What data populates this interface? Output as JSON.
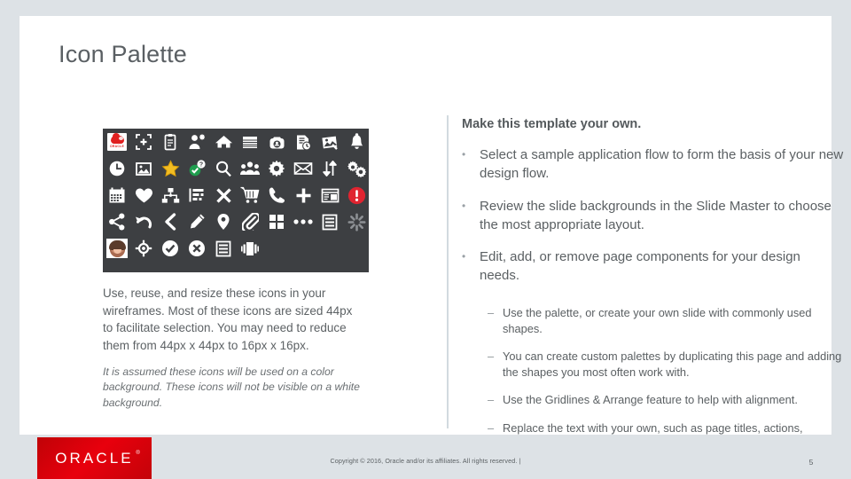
{
  "slide": {
    "title": "Icon Palette",
    "page_number": "5",
    "copyright": "Copyright © 2016, Oracle and/or its affiliates. All rights reserved.  |",
    "logo_text": "ORACLE"
  },
  "colors": {
    "page_background": "#dde2e6",
    "slide_background": "#ffffff",
    "palette_background": "#3d3f42",
    "title_text": "#5a5f63",
    "body_text": "#5b6063",
    "divider": "#d2dadf",
    "oracle_red": "#e8000d",
    "alert_red": "#e02430",
    "star_gold": "#f2bd23",
    "check_green": "#1f9d4e"
  },
  "palette": {
    "rows": [
      [
        {
          "name": "oracle-logo-badge-icon"
        },
        {
          "name": "focus-frame-add-icon"
        },
        {
          "name": "clipboard-icon"
        },
        {
          "name": "add-user-icon"
        },
        {
          "name": "home-icon"
        },
        {
          "name": "table-list-icon"
        },
        {
          "name": "briefcase-camera-icon"
        },
        {
          "name": "document-clock-icon"
        },
        {
          "name": "photo-stack-icon"
        },
        {
          "name": "bell-icon"
        }
      ],
      [
        {
          "name": "clock-icon"
        },
        {
          "name": "image-icon"
        },
        {
          "name": "star-icon"
        },
        {
          "name": "check-question-icon"
        },
        {
          "name": "search-icon"
        },
        {
          "name": "group-people-icon"
        },
        {
          "name": "gear-icon"
        },
        {
          "name": "envelope-icon"
        },
        {
          "name": "sort-arrows-icon"
        },
        {
          "name": "multi-gears-icon"
        }
      ],
      [
        {
          "name": "calendar-icon"
        },
        {
          "name": "heart-icon"
        },
        {
          "name": "org-chart-icon"
        },
        {
          "name": "gantt-chart-icon"
        },
        {
          "name": "close-x-icon"
        },
        {
          "name": "shopping-cart-icon"
        },
        {
          "name": "phone-icon"
        },
        {
          "name": "plus-icon"
        },
        {
          "name": "dashboard-window-icon"
        },
        {
          "name": "alert-circle-icon"
        }
      ],
      [
        {
          "name": "share-icon"
        },
        {
          "name": "undo-icon"
        },
        {
          "name": "chevron-left-icon"
        },
        {
          "name": "pencil-edit-icon"
        },
        {
          "name": "location-pin-icon"
        },
        {
          "name": "paperclip-icon"
        },
        {
          "name": "grid-tiles-icon"
        },
        {
          "name": "more-ellipsis-icon"
        },
        {
          "name": "list-lines-icon"
        },
        {
          "name": "loading-spinner-icon"
        }
      ],
      [
        {
          "name": "avatar-photo-icon"
        },
        {
          "name": "crosshair-target-icon"
        },
        {
          "name": "check-circle-icon"
        },
        {
          "name": "close-circle-icon"
        },
        {
          "name": "list-view-icon"
        },
        {
          "name": "carousel-icon"
        }
      ]
    ]
  },
  "left_notes": {
    "paragraph": "Use, reuse, and resize these icons in your wireframes. Most of these icons are sized 44px to facilitate selection. You may need to reduce them from 44px x 44px to 16px x 16px.",
    "italic_paragraph": "It is assumed these icons will be used on a color background. These icons will not be visible on a white background."
  },
  "right_column": {
    "heading": "Make this template your own.",
    "bullets": [
      {
        "marker": "•",
        "text": "Select a sample application flow to form the basis of your new design flow."
      },
      {
        "marker": "•",
        "text": "Review the slide backgrounds in the Slide Master to choose the most appropriate layout."
      },
      {
        "marker": "•",
        "text": "Edit, add, or remove page components for your design needs."
      }
    ],
    "sub_bullets": [
      {
        "marker": "–",
        "text": "Use the palette, or create your own slide with commonly used shapes."
      },
      {
        "marker": "–",
        "text": "You can create custom palettes by duplicating this page and adding the shapes you most often work with."
      },
      {
        "marker": "–",
        "text": "Use the Gridlines & Arrange feature to help with alignment."
      },
      {
        "marker": "–",
        "text": "Replace the text with your own, such as page titles, actions, descriptions, and so on."
      }
    ]
  }
}
